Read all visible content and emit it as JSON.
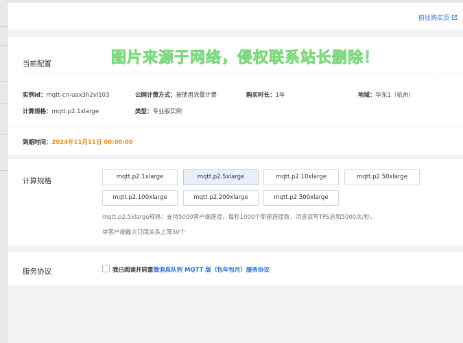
{
  "header": {
    "goto_link_label": "前往购买页"
  },
  "watermark": "图片来源于网络，侵权联系站长删除！",
  "config": {
    "section_title": "当前配置",
    "instance_id": {
      "label": "实例id：",
      "value": "mqtt-cn-uax3h2vl103"
    },
    "billing": {
      "label": "公网计费方式：",
      "value": "按使用流量计费"
    },
    "duration": {
      "label": "购买时长：",
      "value": "1年"
    },
    "region": {
      "label": "地域：",
      "value": "华东1（杭州）"
    },
    "spec": {
      "label": "计算规格：",
      "value": "mqtt.p2.1xlarge"
    },
    "type": {
      "label": "类型：",
      "value": "专业版实例"
    },
    "expire": {
      "label": "到期时间：",
      "value": "2024年11月11日 00:00:00"
    }
  },
  "spec_section": {
    "title": "计算规格",
    "options": [
      "mqtt.p2.1xlarge",
      "mqtt.p2.5xlarge",
      "mqtt.p2.10xlarge",
      "mqtt.p2.50xlarge",
      "mqtt.p2.100xlarge",
      "mqtt.p2.200xlarge",
      "mqtt.p2.500xlarge"
    ],
    "selected": "mqtt.p2.5xlarge",
    "desc_line1": "mqtt.p2.5xlarge规格：支持5000客户端连接，每秒1000个新建连接数，消息读写TPS总和5000次/秒。",
    "desc_line2": "单客户端最大订阅关系上限30个"
  },
  "agreement": {
    "title": "服务协议",
    "text": "我已阅读并同意",
    "link": "微消息队列 MQTT 版（包年包月）服务协议",
    "checked": false
  },
  "colors": {
    "link": "#2a6fd6",
    "expire": "#f08a19",
    "selected_bg": "#e8effa"
  }
}
